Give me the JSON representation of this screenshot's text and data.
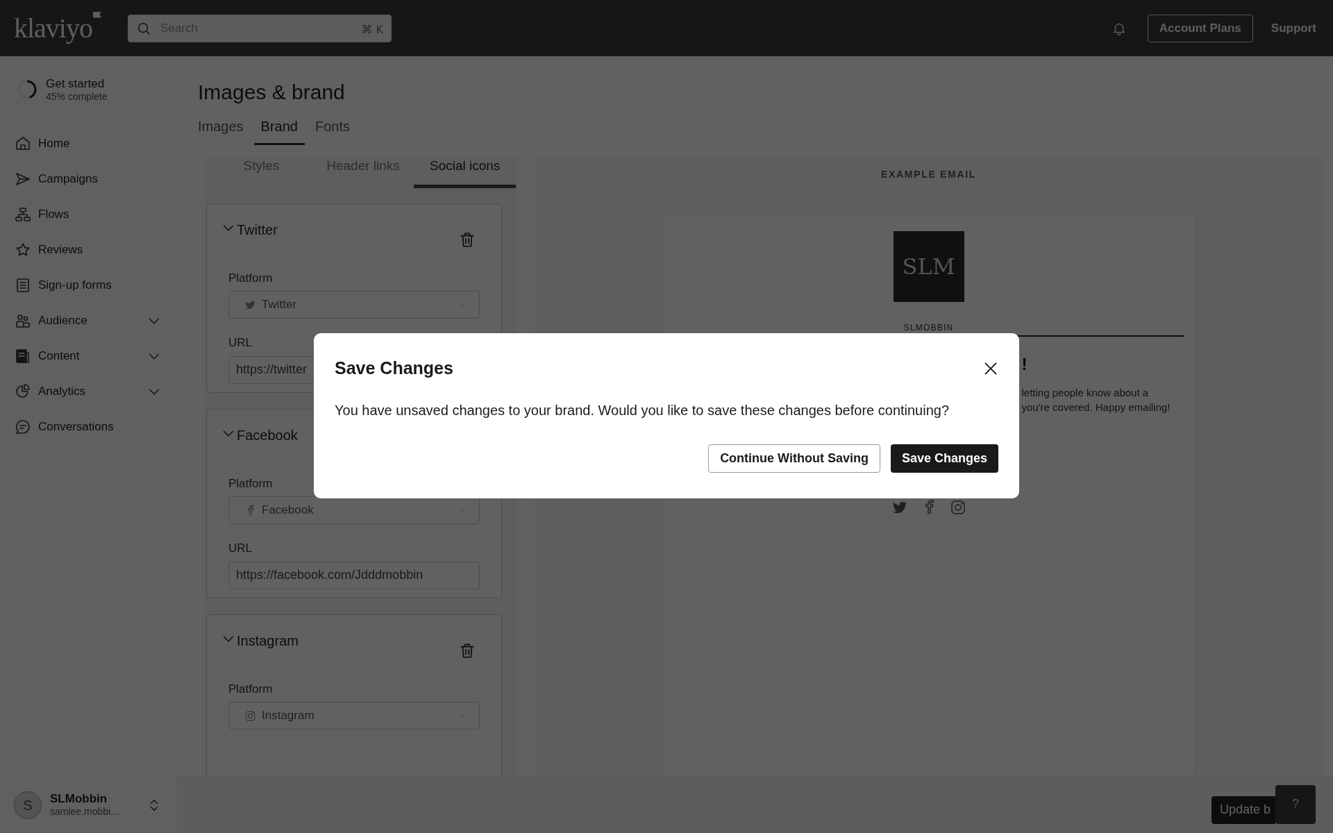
{
  "topbar": {
    "logo": "klaviyo",
    "search": {
      "placeholder": "Search",
      "shortcut": "⌘ K"
    },
    "buttons": [
      {
        "label": "Account Plans",
        "kind": "outline"
      },
      {
        "label": "Support",
        "kind": "plain"
      }
    ]
  },
  "sidebar": {
    "progress": {
      "title": "Get started",
      "subtitle": "45% complete",
      "level": 0.45
    },
    "items": [
      {
        "label": "Home",
        "expandable": false
      },
      {
        "label": "Campaigns",
        "expandable": false
      },
      {
        "label": "Flows",
        "expandable": false
      },
      {
        "label": "Reviews",
        "expandable": false
      },
      {
        "label": "Sign-up forms",
        "expandable": false
      },
      {
        "label": "Audience",
        "expandable": true
      },
      {
        "label": "Content",
        "expandable": true
      },
      {
        "label": "Analytics",
        "expandable": true
      },
      {
        "label": "Conversations",
        "expandable": false
      }
    ],
    "account": {
      "initial": "S",
      "name": "SLMobbin",
      "email": "samlee.mobbi..."
    }
  },
  "page": {
    "title": "Images & brand",
    "tabs": [
      {
        "label": "Images",
        "selected": false
      },
      {
        "label": "Brand",
        "selected": true
      },
      {
        "label": "Fonts",
        "selected": false
      }
    ]
  },
  "editor": {
    "tabs": [
      {
        "label": "Styles",
        "selected": false
      },
      {
        "label": "Header links",
        "selected": false
      },
      {
        "label": "Social icons",
        "selected": true
      }
    ],
    "cards": [
      {
        "title": "Twitter",
        "deletable": true,
        "platform_label": "Platform",
        "platform": "Twitter",
        "url_label": "URL",
        "url": "https://twitter"
      },
      {
        "title": "Facebook",
        "deletable": false,
        "platform_label": "Platform",
        "platform": "Facebook",
        "url_label": "URL",
        "url": "https://facebook.com/Jdddmobbin"
      },
      {
        "title": "Instagram",
        "deletable": true,
        "platform_label": "Platform",
        "platform": "Instagram"
      }
    ]
  },
  "preview": {
    "label": "EXAMPLE EMAIL",
    "logo_text": "SLM",
    "brand": "SLMOBBIN",
    "heading": "!",
    "lines": [
      "letting people know about a",
      "you're covered. Happy emailing!"
    ]
  },
  "dialog": {
    "title": "Save Changes",
    "message": "You have unsaved changes to your brand. Would you like to save these changes before continuing?",
    "buttons": [
      {
        "label": "Continue Without Saving",
        "kind": "secondary"
      },
      {
        "label": "Save Changes",
        "kind": "primary"
      }
    ]
  },
  "footer": {
    "button": "Update b",
    "help": "?"
  }
}
